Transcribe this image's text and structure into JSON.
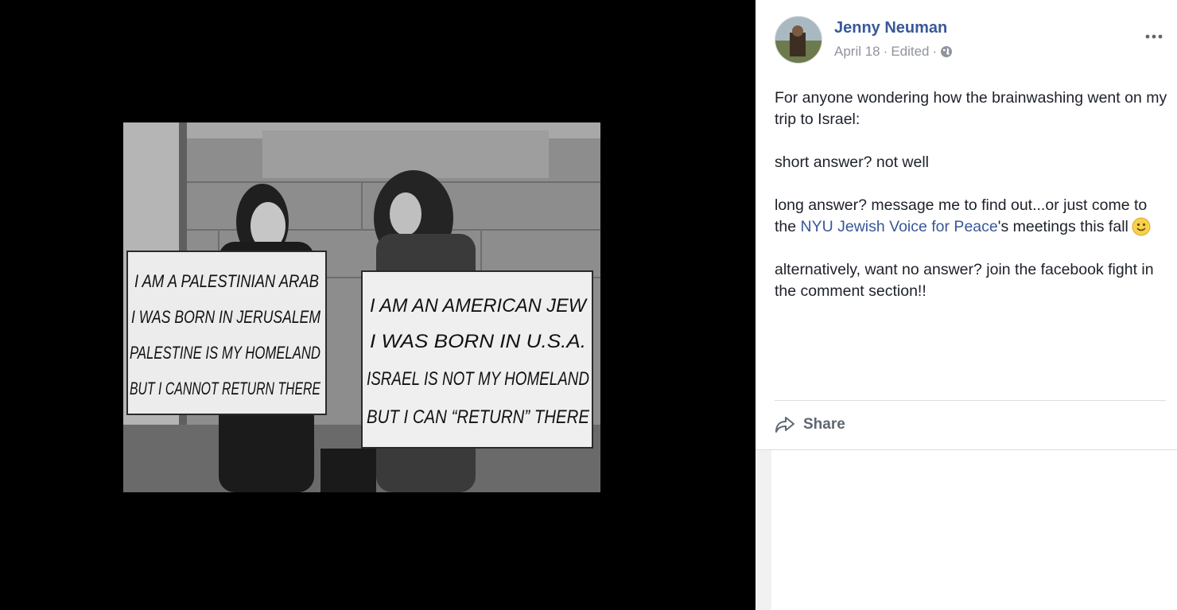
{
  "post": {
    "author": "Jenny Neuman",
    "date": "April 18",
    "edited": "Edited",
    "separator": "·",
    "text": {
      "p1": "For anyone wondering how the brainwashing went on my trip to Israel:",
      "p2": "short answer? not well",
      "p3_before": "long answer? message me to find out...or just come to the ",
      "p3_link": "NYU Jewish Voice for Peace",
      "p3_after": "'s meetings this fall",
      "p4": "alternatively, want no answer? join the facebook fight in the comment section!!"
    },
    "emoji": "smiley-emoji",
    "share_label": "Share"
  },
  "photo": {
    "sign_left": [
      "I AM A PALESTINIAN ARAB",
      "I WAS BORN IN JERUSALEM",
      "PALESTINE IS MY HOMELAND",
      "BUT I CANNOT RETURN THERE"
    ],
    "sign_right": [
      "I AM AN AMERICAN JEW",
      "I WAS BORN IN U.S.A.",
      "ISRAEL IS NOT MY HOMELAND",
      "BUT I CAN “RETURN” THERE"
    ]
  },
  "icons": {
    "globe": "globe-icon",
    "more": "more-options-icon",
    "share": "share-icon"
  },
  "colors": {
    "link": "#385898",
    "text": "#1d2129",
    "meta": "#90949c",
    "background": "#000000"
  }
}
